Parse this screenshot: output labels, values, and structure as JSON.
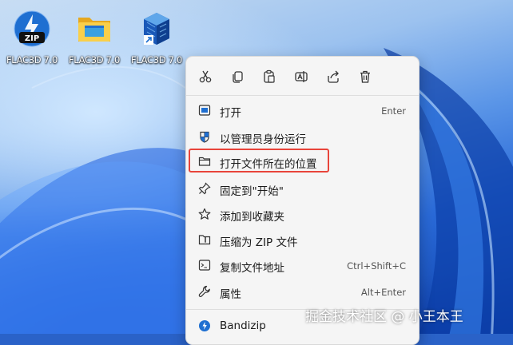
{
  "desktop": {
    "icons": [
      {
        "caption": "FLAC3D 7.0",
        "icon": "zip-archive-icon"
      },
      {
        "caption": "FLAC3D 7.0",
        "icon": "folder-icon"
      },
      {
        "caption": "FLAC3D 7.0",
        "icon": "app-shortcut-icon"
      }
    ],
    "zip_badge": "ZIP"
  },
  "context_menu": {
    "toolbar": [
      {
        "name": "cut",
        "icon": "scissors-icon"
      },
      {
        "name": "copy",
        "icon": "copy-icon"
      },
      {
        "name": "paste",
        "icon": "paste-icon"
      },
      {
        "name": "rename",
        "icon": "rename-icon"
      },
      {
        "name": "share",
        "icon": "share-icon"
      },
      {
        "name": "delete",
        "icon": "trash-icon"
      }
    ],
    "items": [
      {
        "label": "打开",
        "shortcut": "Enter",
        "icon": "open-window-icon"
      },
      {
        "label": "以管理员身份运行",
        "shortcut": "",
        "icon": "shield-icon"
      },
      {
        "label": "打开文件所在的位置",
        "shortcut": "",
        "icon": "folder-outline-icon",
        "highlighted": true
      },
      {
        "label": "固定到\"开始\"",
        "shortcut": "",
        "icon": "pin-icon"
      },
      {
        "label": "添加到收藏夹",
        "shortcut": "",
        "icon": "star-icon"
      },
      {
        "label": "压缩为 ZIP 文件",
        "shortcut": "",
        "icon": "zip-compress-icon"
      },
      {
        "label": "复制文件地址",
        "shortcut": "Ctrl+Shift+C",
        "icon": "copy-path-icon"
      },
      {
        "label": "属性",
        "shortcut": "Alt+Enter",
        "icon": "wrench-icon"
      },
      {
        "label": "Bandizip",
        "shortcut": "",
        "icon": "bandizip-icon"
      }
    ]
  },
  "watermark": "掘金技术社区 @ 小王本王",
  "colors": {
    "highlight_border": "#e8443a",
    "menu_bg": "#f5f5f5",
    "accent_blue": "#1f6fd1"
  }
}
